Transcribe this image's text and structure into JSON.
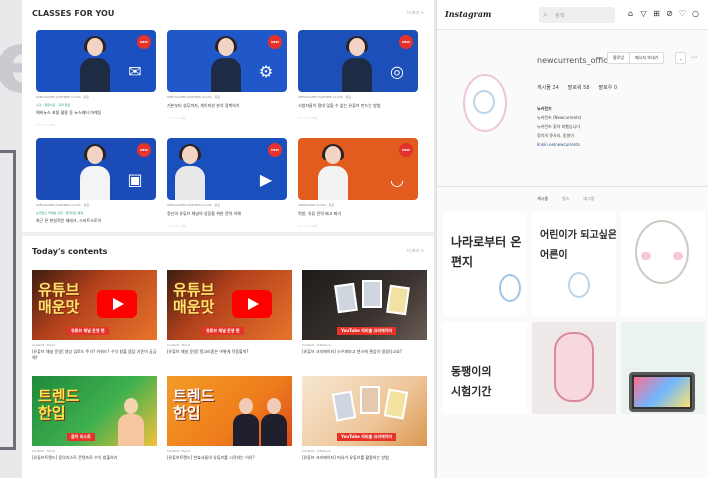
{
  "classes": {
    "title": "CLASSES FOR YOU",
    "more": "더 보기 >",
    "cards": [
      {
        "meta": "SPECIALIZED PARTNER CLASS · 유료",
        "meta2": "수강 · 업데이트 · 강좌 완료",
        "title": "해외뉴스 포털 활용 동 뉴스레터 마케팅",
        "stars": "☆☆☆☆☆ (0)",
        "badge": "NEW",
        "bg": "#1c4fbf",
        "icon": "✉"
      },
      {
        "meta": "SPECIALIZED PARTNER CLASS · 유료",
        "meta2": "",
        "title": "기본부터 실무까지, 게이미션 분석 정복하기",
        "stars": "☆☆☆☆☆ (0)",
        "badge": "NEW",
        "bg": "#2058c9",
        "icon": "⚙"
      },
      {
        "meta": "SPECIALIZED PARTNER CLASS · 유료",
        "meta2": "",
        "title": "시청자들이 절대 잊을 수 없는 유튜브 만드는 방법",
        "stars": "☆☆☆☆☆ (0)",
        "badge": "NEW",
        "bg": "#1d4fb8",
        "icon": "◎"
      },
      {
        "meta": "SPECIALIZED PARTNER CLASS · 유료",
        "meta2": "뉴커런츠 마케팅 강좌 · 업데이트 예정",
        "title": "최근 폰 현실적인 재테크, 스마트스토어",
        "stars": "☆☆☆☆☆ (0)",
        "badge": "NEW",
        "bg": "#1b4bb7",
        "icon": "▣"
      },
      {
        "meta": "SPECIALIZED PARTNER CLASS · 유료",
        "meta2": "",
        "title": "정신의 유튜브 채널의 성장을 위한 전략 이해",
        "stars": "☆☆☆☆☆ (0)",
        "badge": "NEW",
        "bg": "#1a4fbe",
        "icon": "▶"
      },
      {
        "meta": "SIGNATURE CLASS · 유료",
        "meta2": "",
        "title": "먹방, 유튜 전략 짜고 짜기",
        "stars": "☆☆☆☆☆ (0)",
        "badge": "NEW",
        "bg": "#e25b1f",
        "icon": "◡"
      }
    ]
  },
  "today": {
    "title": "Today's contents",
    "more": "더 보기 >",
    "cards": [
      {
        "meta": "Content · Trend",
        "title": "[유튜브 채널 운영] 영상 업로드 주기? 키워드? 수익 창출 몸담 기준이 궁금해?",
        "kr": "유튜브\n매운맛",
        "strip": "유튜브 채널 운영 편",
        "style": "orange"
      },
      {
        "meta": "Content · Trend",
        "title": "[유튜브 채널 운영] 알고리즘은 어떻게 작동할까?",
        "kr": "유튜브\n매운맛",
        "strip": "유튜브 채널 운영 편",
        "style": "orange"
      },
      {
        "meta": "Content · Influence",
        "title": "[유튜브 크리에이터] 스우파보고 댄스에 관심이 생겼다고요?",
        "kr": "",
        "strip": "YouTube 차비슬 크리에이터",
        "style": "dark"
      },
      {
        "meta": "Content · Trend",
        "title": "[유튜브트렌드] 음악리스트 콘텐츠로 수익 창출하기",
        "kr": "트렌드\n한입",
        "strip": "음악 리스트",
        "style": "green"
      },
      {
        "meta": "Content · Trend",
        "title": "[유튜브트렌드] 반효사들의 유튜브를 시작하는 이유?",
        "kr": "트렌드\n한입",
        "strip": "",
        "style": "orange2"
      },
      {
        "meta": "Content · Influence",
        "title": "[유튜브 크리에이터] 떠사가 유튜브를 활용하는 방법",
        "kr": "",
        "strip": "YouTube 차비슬 크리에이터",
        "style": "cream"
      }
    ]
  },
  "instagram": {
    "logo": "Instagram",
    "search_placeholder": "검색",
    "username": "newcurrents_official",
    "follow_btn": "팔로잉",
    "msg_btn": "메시지 보내기",
    "stats": [
      "게시물 24",
      "팔로워 58",
      "팔로우 0"
    ],
    "bio": [
      "뉴커런츠",
      "뉴커런츠 (Newcurrents)",
      "뉴커런츠 좋아 피했습니다",
      "정치의 큐사지, 동원이",
      "linkin.ee/newcurrents"
    ],
    "tabs": [
      "게시물",
      "릴스",
      "태그됨"
    ],
    "posts": [
      {
        "text": "나라로부터 온\n편지"
      },
      {
        "text": "어린이가 되고싶은\n어른이"
      },
      {
        "text": ""
      },
      {
        "text": "동팽이의\n시험기간"
      },
      {
        "text": ""
      },
      {
        "text": ""
      }
    ]
  }
}
